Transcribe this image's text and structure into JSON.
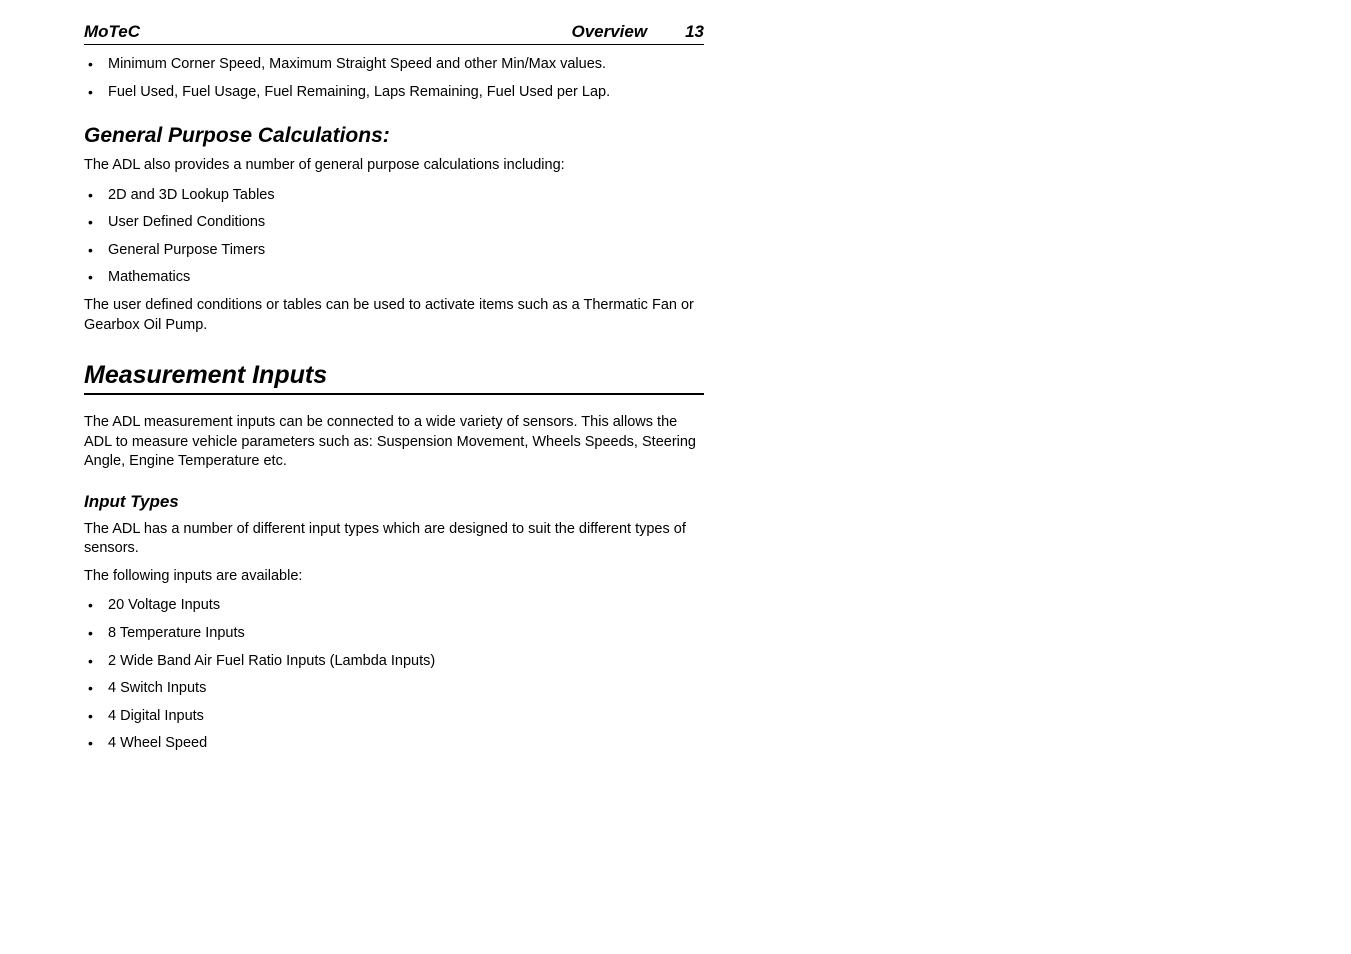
{
  "header": {
    "brand": "MoTeC",
    "section": "Overview",
    "page": "13"
  },
  "top_bullets": [
    "Minimum Corner Speed, Maximum Straight Speed and other Min/Max values.",
    "Fuel Used, Fuel Usage, Fuel Remaining, Laps Remaining, Fuel Used per Lap."
  ],
  "gpc": {
    "heading": "General Purpose Calculations:",
    "intro": "The ADL also provides a number of general purpose calculations including:",
    "items": [
      "2D and 3D Lookup Tables",
      "User Defined Conditions",
      "General Purpose Timers",
      "Mathematics"
    ],
    "outro": "The user defined conditions or tables can be used to activate items such as a Thermatic Fan or Gearbox Oil Pump."
  },
  "mi": {
    "heading": "Measurement Inputs",
    "intro": "The ADL measurement inputs can be connected to a wide variety of sensors. This allows the ADL to measure vehicle parameters such as: Suspension Movement, Wheels Speeds, Steering Angle, Engine Temperature etc.",
    "input_types_heading": "Input Types",
    "input_types_intro": "The ADL has a number of different input types which are designed to suit the different types of sensors.",
    "inputs_available_intro": "The following inputs are available:",
    "inputs": [
      "20 Voltage Inputs",
      "8 Temperature Inputs",
      "2 Wide Band Air Fuel Ratio Inputs (Lambda Inputs)",
      "4 Switch Inputs",
      "4 Digital Inputs",
      "4 Wheel Speed"
    ]
  }
}
